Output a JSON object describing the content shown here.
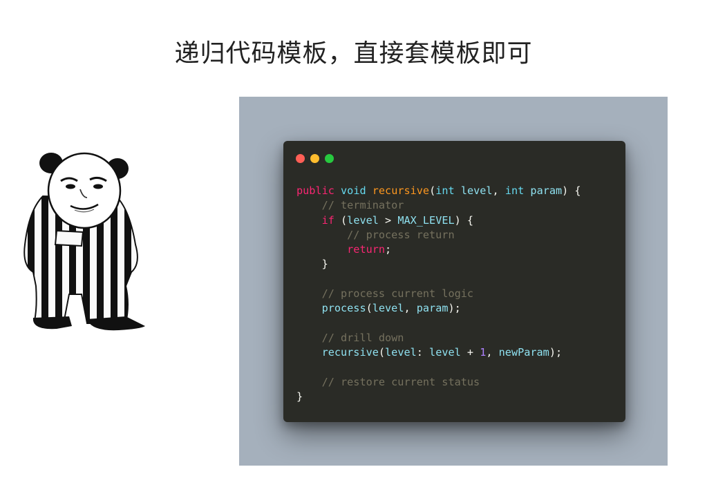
{
  "slide": {
    "title": "递归代码模板，直接套模板即可"
  },
  "window_controls": [
    {
      "name": "close-dot",
      "color": "#ff5f56"
    },
    {
      "name": "minimize-dot",
      "color": "#ffbd2e"
    },
    {
      "name": "maximize-dot",
      "color": "#27c93f"
    }
  ],
  "code_lines": [
    [
      [
        "public",
        "kw"
      ],
      [
        " ",
        "plain"
      ],
      [
        "void",
        "type"
      ],
      [
        " ",
        "plain"
      ],
      [
        "recursive",
        "fn"
      ],
      [
        "(",
        "pun"
      ],
      [
        "int",
        "type"
      ],
      [
        " ",
        "plain"
      ],
      [
        "level",
        "var"
      ],
      [
        ", ",
        "pun"
      ],
      [
        "int",
        "type"
      ],
      [
        " ",
        "plain"
      ],
      [
        "param",
        "var"
      ],
      [
        ") {",
        "pun"
      ]
    ],
    [
      [
        "    ",
        "plain"
      ],
      [
        "// terminator",
        "com"
      ]
    ],
    [
      [
        "    ",
        "plain"
      ],
      [
        "if",
        "kw"
      ],
      [
        " (",
        "pun"
      ],
      [
        "level",
        "var"
      ],
      [
        " > ",
        "pun"
      ],
      [
        "MAX_LEVEL",
        "var"
      ],
      [
        ") {",
        "pun"
      ]
    ],
    [
      [
        "        ",
        "plain"
      ],
      [
        "// process return",
        "com"
      ]
    ],
    [
      [
        "        ",
        "plain"
      ],
      [
        "return",
        "kw"
      ],
      [
        ";",
        "pun"
      ]
    ],
    [
      [
        "    ",
        "plain"
      ],
      [
        "}",
        "pun"
      ]
    ],
    [
      [
        "",
        "plain"
      ]
    ],
    [
      [
        "    ",
        "plain"
      ],
      [
        "// process current logic",
        "com"
      ]
    ],
    [
      [
        "    ",
        "plain"
      ],
      [
        "process",
        "var"
      ],
      [
        "(",
        "pun"
      ],
      [
        "level",
        "var"
      ],
      [
        ", ",
        "pun"
      ],
      [
        "param",
        "var"
      ],
      [
        ");",
        "pun"
      ]
    ],
    [
      [
        "",
        "plain"
      ]
    ],
    [
      [
        "    ",
        "plain"
      ],
      [
        "// drill down",
        "com"
      ]
    ],
    [
      [
        "    ",
        "plain"
      ],
      [
        "recursive",
        "var"
      ],
      [
        "(",
        "pun"
      ],
      [
        "level",
        "var"
      ],
      [
        ": ",
        "pun"
      ],
      [
        "level",
        "var"
      ],
      [
        " + ",
        "pun"
      ],
      [
        "1",
        "num"
      ],
      [
        ", ",
        "pun"
      ],
      [
        "newParam",
        "var"
      ],
      [
        ");",
        "pun"
      ]
    ],
    [
      [
        "",
        "plain"
      ]
    ],
    [
      [
        "    ",
        "plain"
      ],
      [
        "// restore current status",
        "com"
      ]
    ],
    [
      [
        "}",
        "pun"
      ]
    ]
  ]
}
